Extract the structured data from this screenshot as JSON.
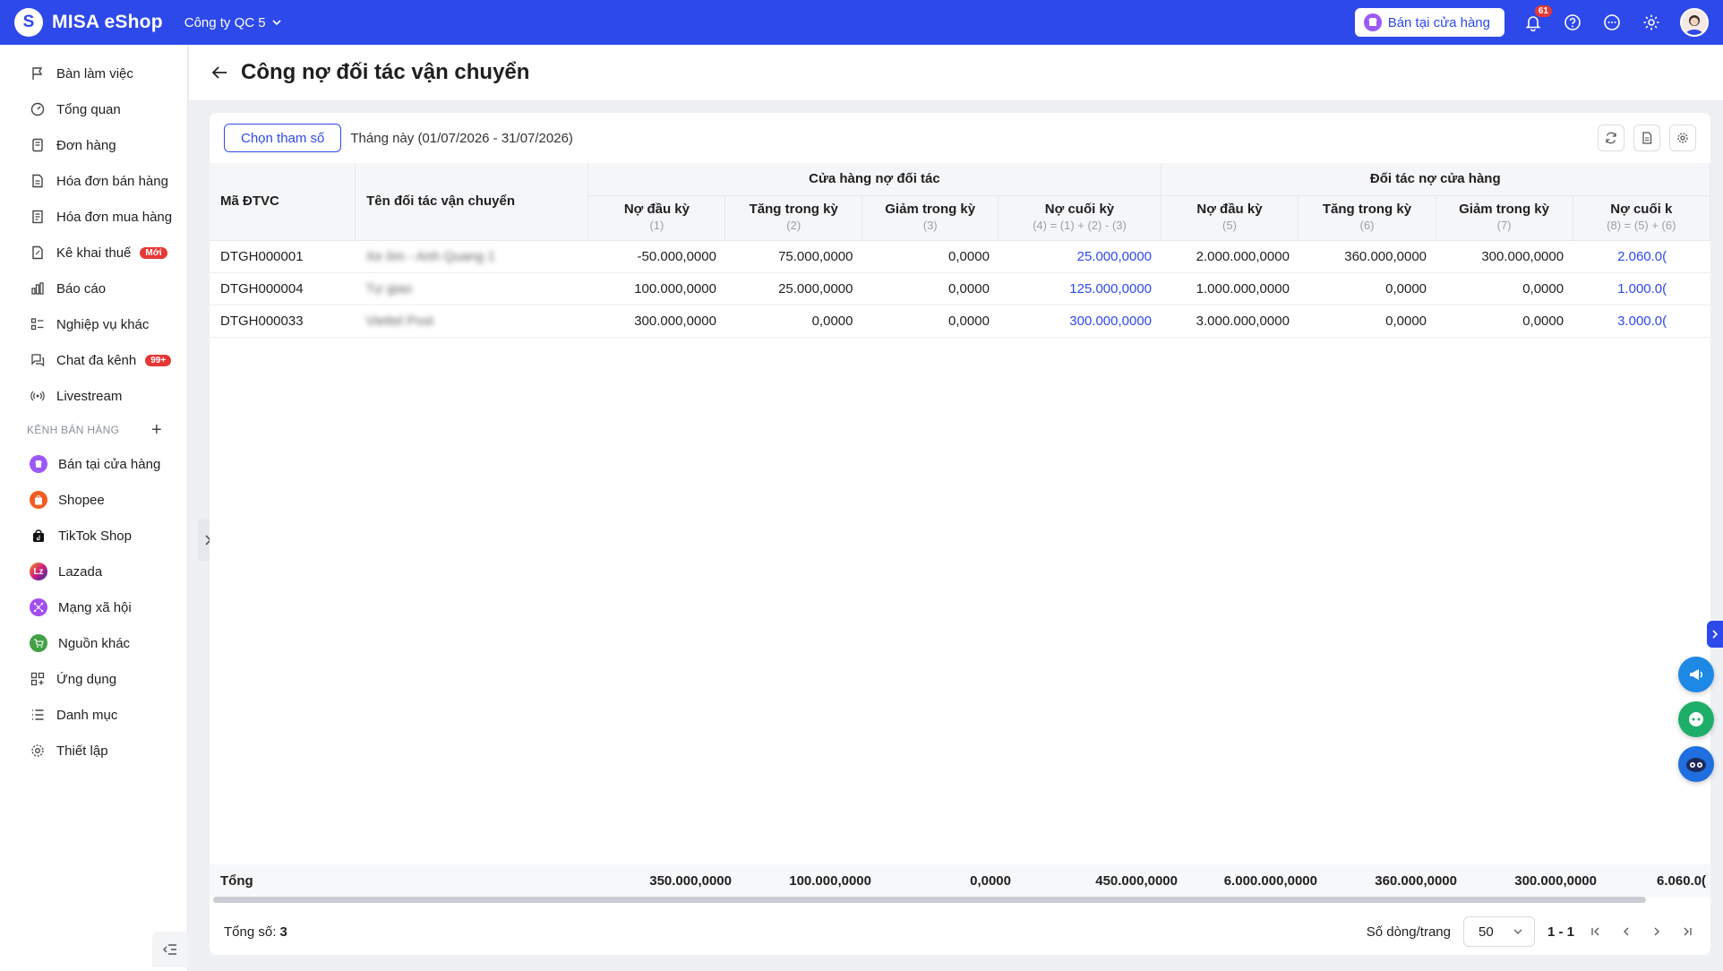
{
  "app": {
    "logo_letter": "S",
    "name": "MISA eShop",
    "company": "Công ty QC 5",
    "store_button": "Bán tại cửa hàng",
    "notifications_count": "61",
    "accent_color": "#2e49ea"
  },
  "sidebar": {
    "items": [
      {
        "label": "Bàn làm việc",
        "icon": "flag-icon"
      },
      {
        "label": "Tổng quan",
        "icon": "dashboard-icon"
      },
      {
        "label": "Đơn hàng",
        "icon": "order-icon"
      },
      {
        "label": "Hóa đơn bán hàng",
        "icon": "invoice-icon"
      },
      {
        "label": "Hóa đơn mua hàng",
        "icon": "purchase-invoice-icon"
      },
      {
        "label": "Kê khai thuế",
        "icon": "tax-icon",
        "badge": "Mới"
      },
      {
        "label": "Báo cáo",
        "icon": "report-icon"
      },
      {
        "label": "Nghiệp vụ khác",
        "icon": "list-icon"
      },
      {
        "label": "Chat đa kênh",
        "icon": "chat-icon",
        "badge": "99+"
      },
      {
        "label": "Livestream",
        "icon": "broadcast-icon"
      }
    ],
    "channel_header": "KÊNH BÁN HÀNG",
    "channels": [
      {
        "label": "Bán tại cửa hàng",
        "color": "#9b59f5"
      },
      {
        "label": "Shopee",
        "color": "#f05d23"
      },
      {
        "label": "TikTok Shop",
        "color": "#111111"
      },
      {
        "label": "Lazada",
        "color": "#2a2fb3"
      },
      {
        "label": "Mạng xã hội",
        "color": "#a24df0"
      },
      {
        "label": "Nguồn khác",
        "color": "#43a047"
      }
    ],
    "bottom_items": [
      {
        "label": "Ứng dụng",
        "icon": "apps-icon"
      },
      {
        "label": "Danh mục",
        "icon": "catalog-icon"
      },
      {
        "label": "Thiết lập",
        "icon": "settings-icon"
      }
    ]
  },
  "page": {
    "title": "Công nợ đối tác vận chuyển"
  },
  "toolbar": {
    "param_button": "Chọn tham số",
    "period": "Tháng này (01/07/2026 - 31/07/2026)"
  },
  "table": {
    "col_code": "Mã ĐTVC",
    "col_name": "Tên đối tác vận chuyển",
    "group1": "Cửa hàng nợ đối tác",
    "group2": "Đối tác nợ cửa hàng",
    "sub_headers": [
      {
        "label": "Nợ đầu kỳ",
        "note": "(1)"
      },
      {
        "label": "Tăng trong kỳ",
        "note": "(2)"
      },
      {
        "label": "Giảm trong kỳ",
        "note": "(3)"
      },
      {
        "label": "Nợ cuối kỳ",
        "note": "(4) = (1) + (2) - (3)"
      },
      {
        "label": "Nợ đầu kỳ",
        "note": "(5)"
      },
      {
        "label": "Tăng trong kỳ",
        "note": "(6)"
      },
      {
        "label": "Giảm trong kỳ",
        "note": "(7)"
      },
      {
        "label": "Nợ cuối k",
        "note": "(8) = (5) + (6)"
      }
    ],
    "rows": [
      {
        "code": "DTGH000001",
        "name": "Xe ôm - Anh Quang 1",
        "v": [
          "-50.000,0000",
          "75.000,0000",
          "0,0000",
          "25.000,0000",
          "2.000.000,0000",
          "360.000,0000",
          "300.000,0000",
          "2.060.0("
        ]
      },
      {
        "code": "DTGH000004",
        "name": "Tự giao",
        "v": [
          "100.000,0000",
          "25.000,0000",
          "0,0000",
          "125.000,0000",
          "1.000.000,0000",
          "0,0000",
          "0,0000",
          "1.000.0("
        ]
      },
      {
        "code": "DTGH000033",
        "name": "Viettel Post",
        "v": [
          "300.000,0000",
          "0,0000",
          "0,0000",
          "300.000,0000",
          "3.000.000,0000",
          "0,0000",
          "0,0000",
          "3.000.0("
        ]
      }
    ],
    "total": {
      "label": "Tổng",
      "v": [
        "350.000,0000",
        "100.000,0000",
        "0,0000",
        "450.000,0000",
        "6.000.000,0000",
        "360.000,0000",
        "300.000,0000",
        "6.060.0("
      ]
    }
  },
  "footer": {
    "total_label": "Tổng số:",
    "total_value": "3",
    "rows_per_page_label": "Số dòng/trang",
    "rows_per_page": "50",
    "range": "1 - 1"
  }
}
